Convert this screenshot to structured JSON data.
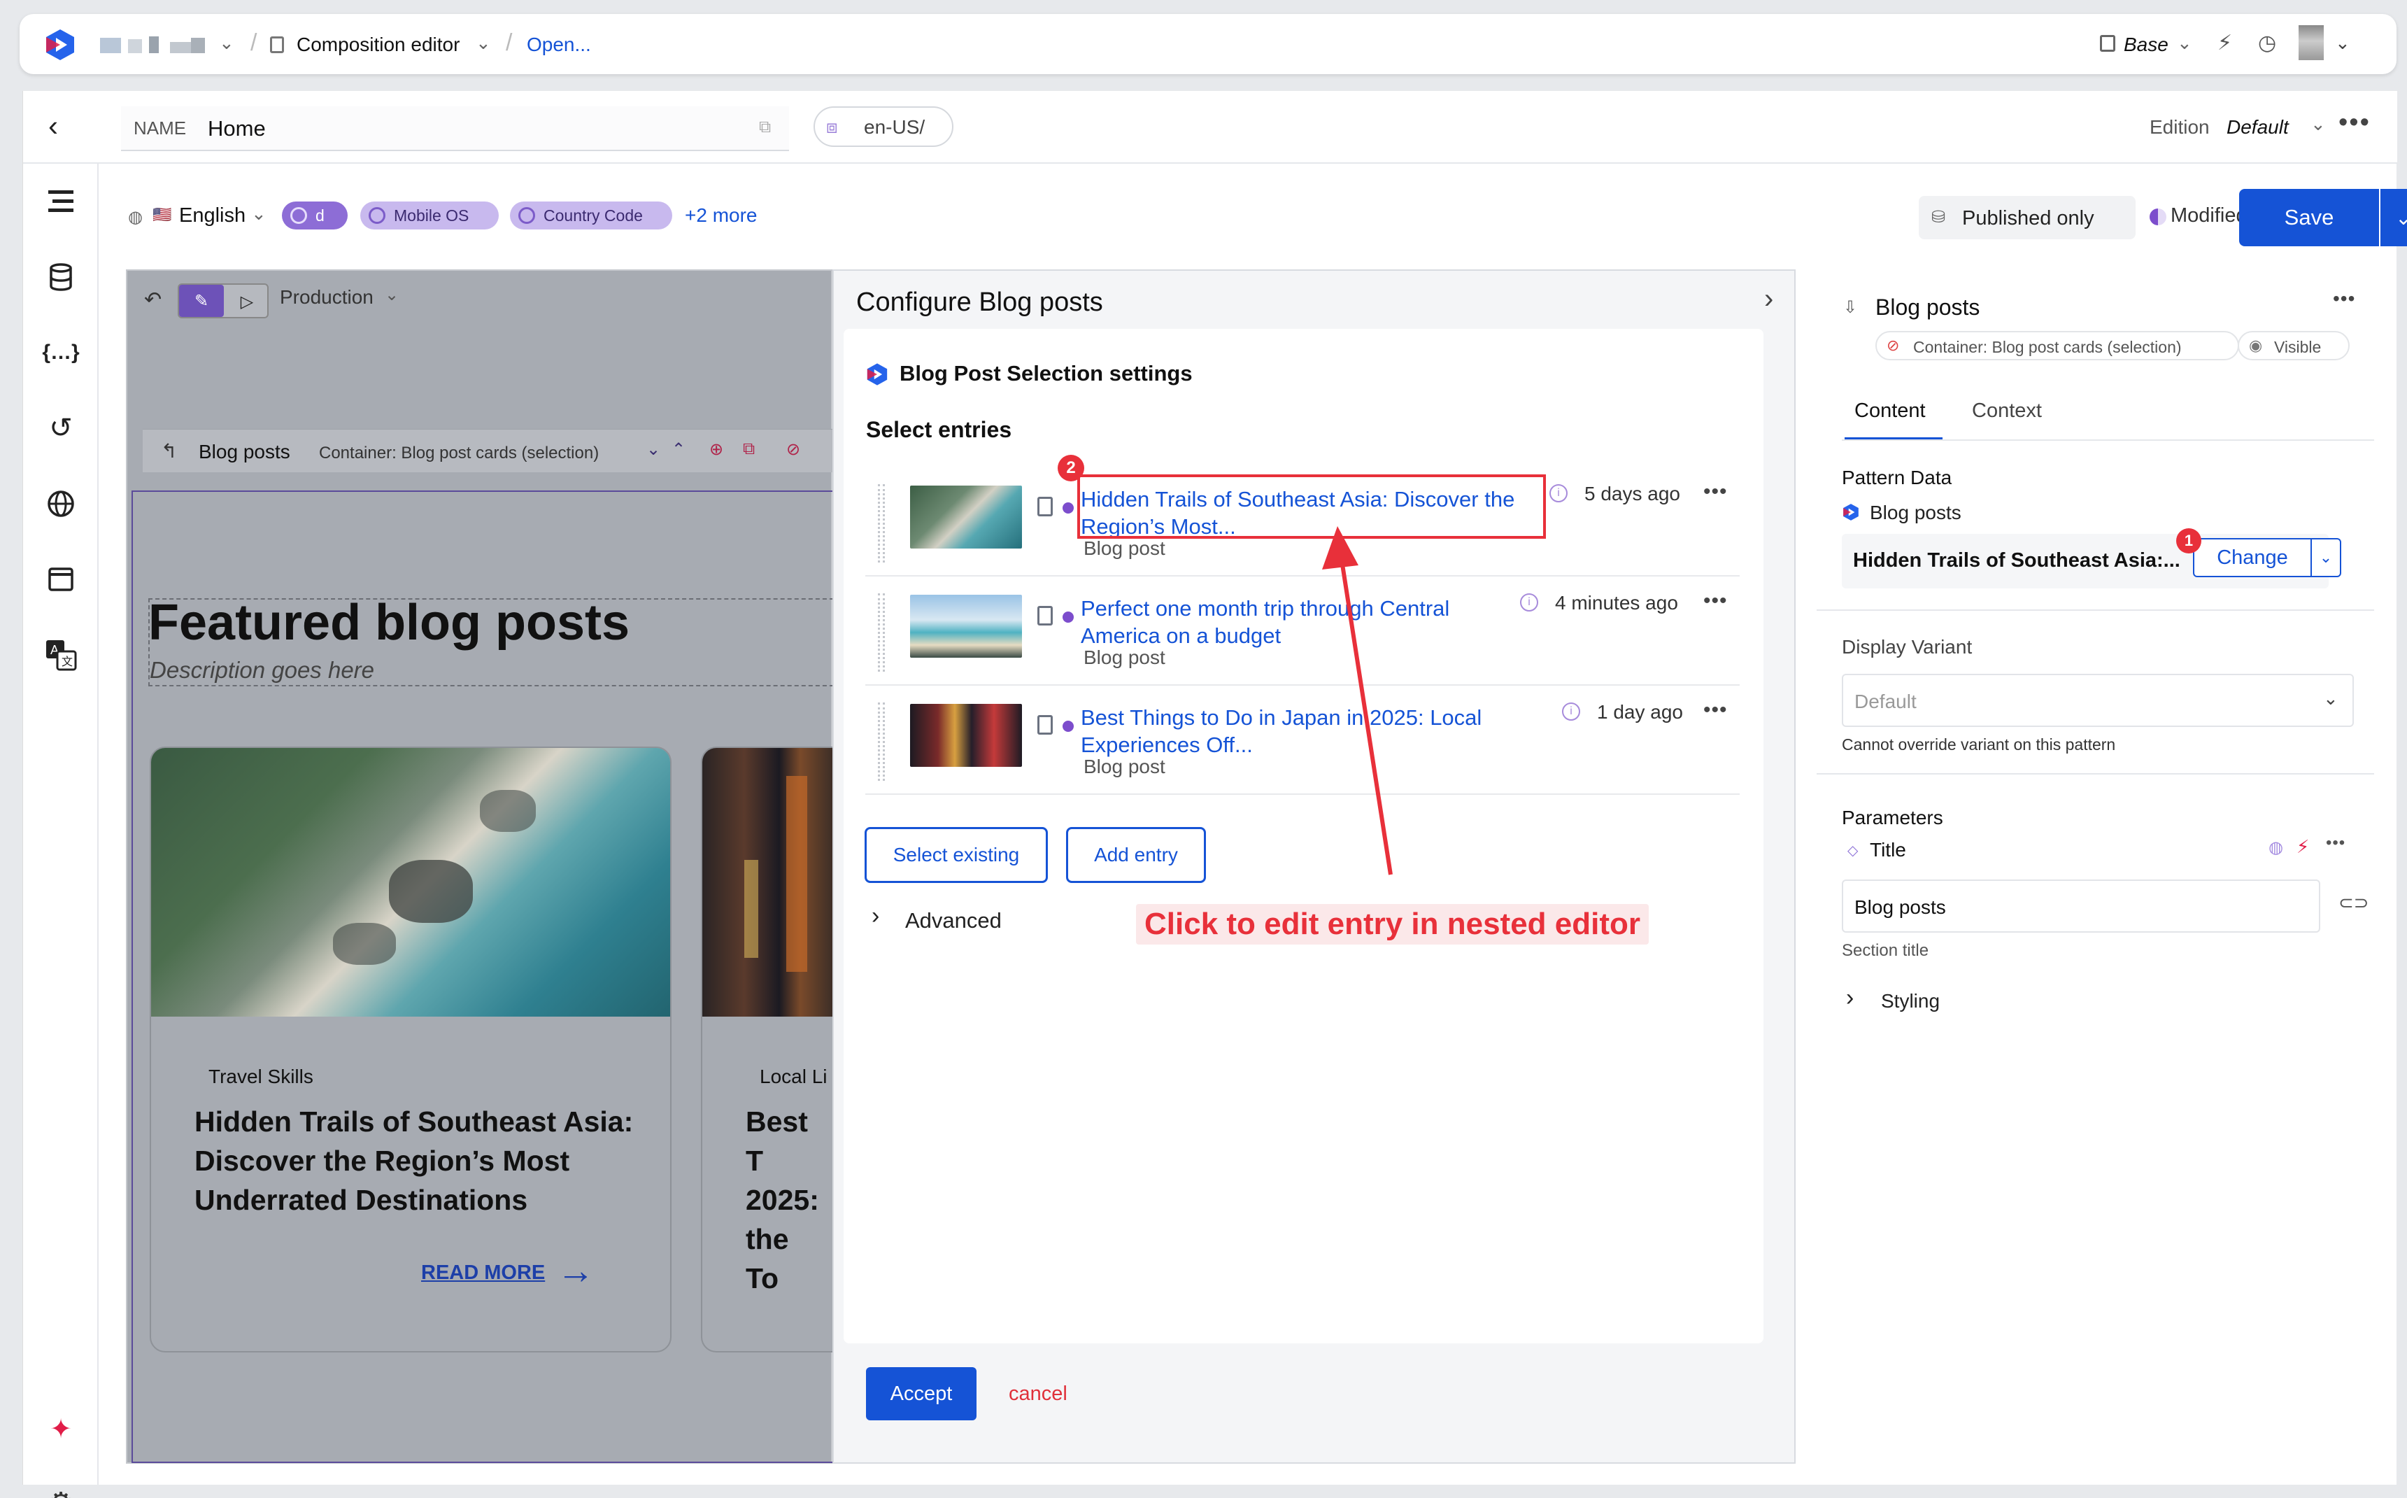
{
  "topbar": {
    "breadcrumb_editor": "Composition editor",
    "breadcrumb_open": "Open...",
    "base_label": "Base"
  },
  "header": {
    "name_label": "NAME",
    "name_value": "Home",
    "locale_path": "en-US/",
    "edition_label": "Edition",
    "edition_value": "Default"
  },
  "toolbar": {
    "language": "English",
    "chips": [
      "d",
      "Mobile OS",
      "Country Code"
    ],
    "more_chips": "+2 more",
    "published_only": "Published only",
    "modified": "Modified",
    "save": "Save"
  },
  "canvas": {
    "environment": "Production",
    "component_name": "Blog posts",
    "component_container": "Container: Blog post cards (selection)",
    "section_title": "Featured blog posts",
    "section_description": "Description goes here",
    "card1_category": "Travel Skills",
    "card1_title": "Hidden Trails of Southeast Asia: Discover the Region’s Most Underrated Destinations",
    "card1_link": "READ MORE",
    "card2_category": "Local Li",
    "card2_title": "Best T 2025: the To"
  },
  "dialog": {
    "title": "Configure Blog posts",
    "settings_title": "Blog Post Selection settings",
    "select_entries": "Select entries",
    "entries": [
      {
        "title": "Hidden Trails of Southeast Asia: Discover the Region’s Most...",
        "type": "Blog post",
        "time": "5 days ago"
      },
      {
        "title": "Perfect one month trip through Central America on a budget",
        "type": "Blog post",
        "time": "4 minutes ago"
      },
      {
        "title": "Best Things to Do in Japan in 2025: Local Experiences Off...",
        "type": "Blog post",
        "time": "1 day ago"
      }
    ],
    "select_existing": "Select existing",
    "add_entry": "Add entry",
    "advanced": "Advanced",
    "accept": "Accept",
    "cancel": "cancel",
    "annotation": "Click to edit entry in nested editor",
    "badge_2": "2"
  },
  "right_panel": {
    "title": "Blog posts",
    "container": "Container: Blog post cards (selection)",
    "visible": "Visible",
    "tab_content": "Content",
    "tab_context": "Context",
    "pattern_data": "Pattern Data",
    "pattern_source": "Blog posts",
    "pattern_entry": "Hidden Trails of Southeast Asia:...",
    "change": "Change",
    "badge_1": "1",
    "display_variant": "Display Variant",
    "variant_placeholder": "Default",
    "variant_note": "Cannot override variant on this pattern",
    "parameters": "Parameters",
    "param_title": "Title",
    "param_value": "Blog posts",
    "param_hint": "Section title",
    "styling": "Styling"
  },
  "colors": {
    "accent": "#1553d6",
    "annotation": "#e8303a",
    "chip": "#c8b9ee"
  }
}
